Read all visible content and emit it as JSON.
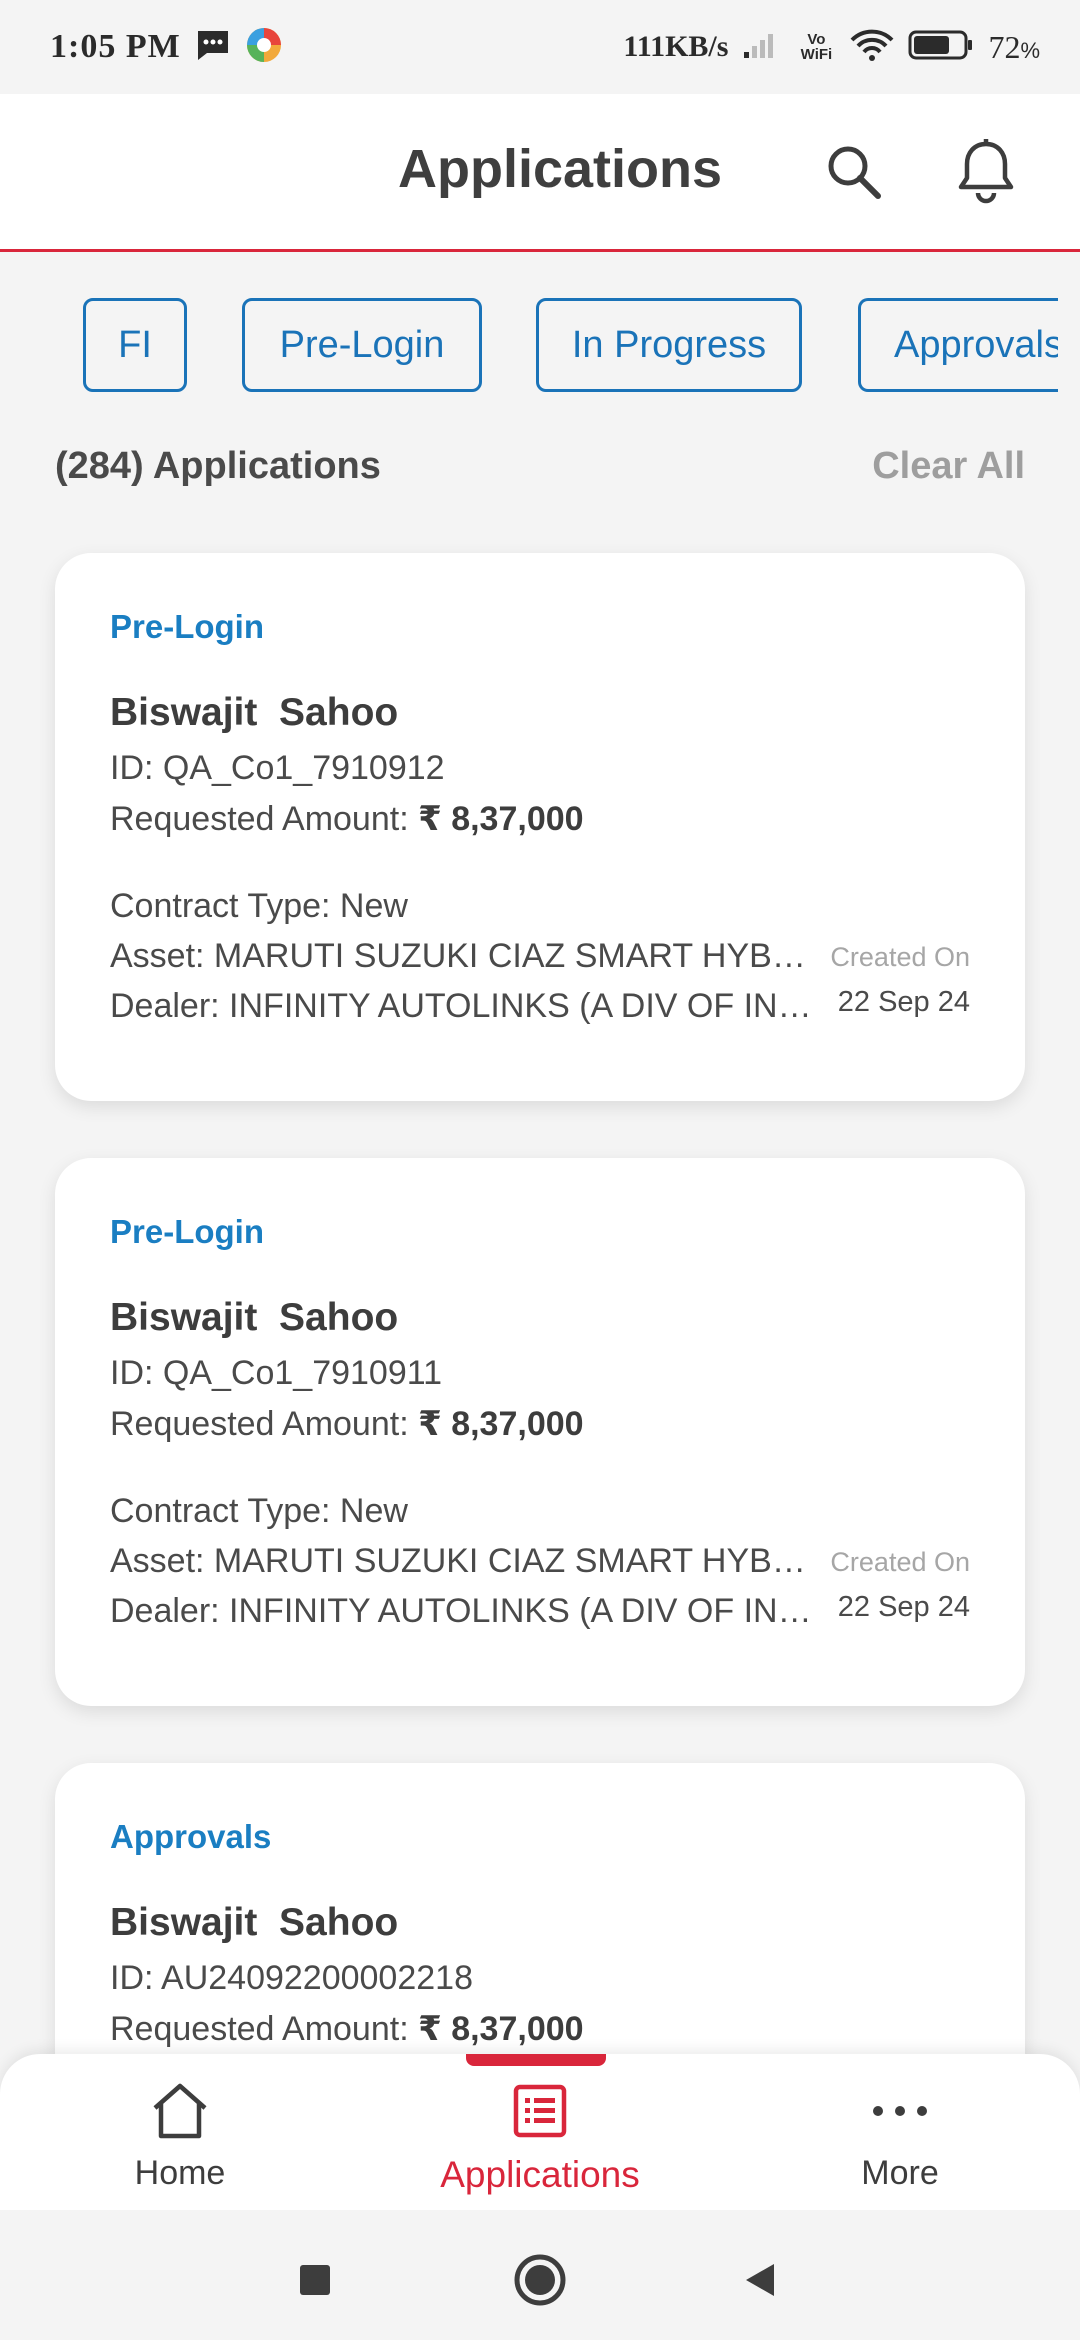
{
  "status_bar": {
    "time": "1:05 PM",
    "network_speed": "111KB/s",
    "vowifi": "Vo WiFi",
    "battery_percent": "72",
    "battery_symbol": "%",
    "battery_level": 0.72
  },
  "header": {
    "title": "Applications",
    "accent_color": "#d9263b"
  },
  "filters": [
    {
      "label": "FI"
    },
    {
      "label": "Pre-Login"
    },
    {
      "label": "In Progress"
    },
    {
      "label": "Approvals"
    }
  ],
  "summary": {
    "count_text": "(284) Applications",
    "clear_label": "Clear All"
  },
  "applications": [
    {
      "status": "Pre-Login",
      "name": "Biswajit  Sahoo",
      "id_label": "ID: QA_Co1_7910912",
      "amount_label": "Requested Amount: ",
      "amount_value": "₹ 8,37,000",
      "contract": "Contract Type: New",
      "asset": "Asset: MARUTI SUZUKI CIAZ SMART HYBRID ...",
      "dealer": "Dealer: INFINITY AUTOLINKS (A DIV OF INFINITY ...",
      "created_label": "Created On",
      "created_date": "22 Sep 24"
    },
    {
      "status": "Pre-Login",
      "name": "Biswajit  Sahoo",
      "id_label": "ID: QA_Co1_7910911",
      "amount_label": "Requested Amount: ",
      "amount_value": "₹ 8,37,000",
      "contract": "Contract Type: New",
      "asset": "Asset: MARUTI SUZUKI CIAZ SMART HYBRID ...",
      "dealer": "Dealer: INFINITY AUTOLINKS (A DIV OF INFINITY ...",
      "created_label": "Created On",
      "created_date": "22 Sep 24"
    },
    {
      "status": "Approvals",
      "name": "Biswajit  Sahoo",
      "id_label": "ID: AU24092200002218",
      "amount_label": "Requested Amount: ",
      "amount_value": "₹ 8,37,000"
    }
  ],
  "bottom_nav": {
    "items": [
      {
        "label": "Home",
        "icon": "home-icon"
      },
      {
        "label": "Applications",
        "icon": "applications-icon",
        "active": true
      },
      {
        "label": "More",
        "icon": "more-icon"
      }
    ]
  },
  "system_nav": {
    "icons": [
      "recents-icon",
      "home-circle-icon",
      "back-icon"
    ]
  }
}
